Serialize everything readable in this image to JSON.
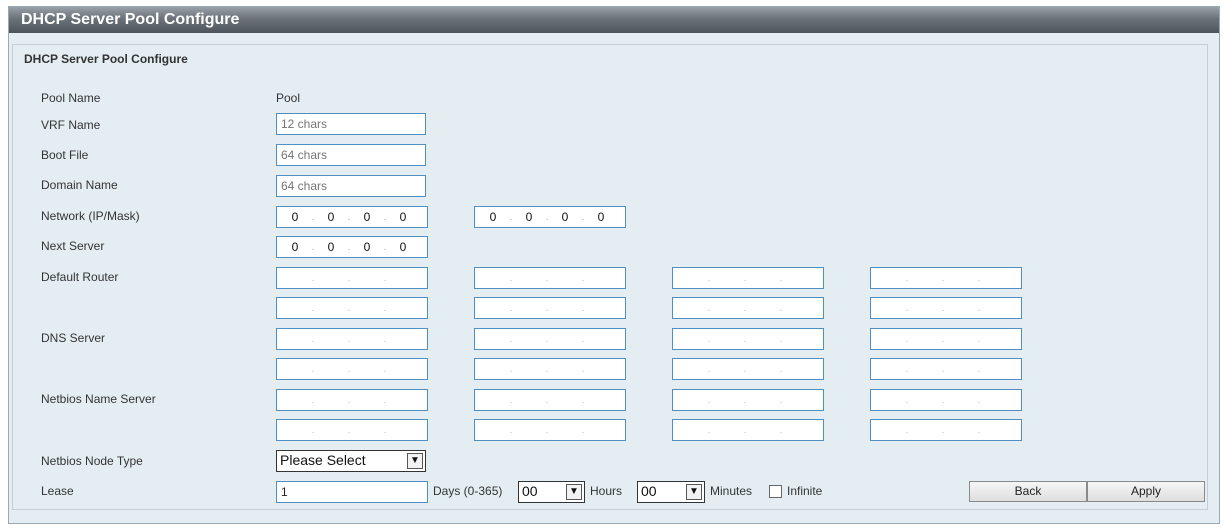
{
  "window": {
    "title": "DHCP Server Pool Configure"
  },
  "group_title": "DHCP Server Pool Configure",
  "labels": {
    "pool_name": "Pool Name",
    "vrf_name": "VRF Name",
    "boot_file": "Boot File",
    "domain_name": "Domain Name",
    "network": "Network (IP/Mask)",
    "next_server": "Next Server",
    "default_router": "Default Router",
    "dns_server": "DNS Server",
    "netbios_name_server": "Netbios Name Server",
    "netbios_node_type": "Netbios Node Type",
    "lease": "Lease"
  },
  "values": {
    "pool_name": "Pool",
    "vrf_placeholder": "12 chars",
    "boot_file_placeholder": "64 chars",
    "domain_name_placeholder": "64 chars",
    "ip_zero": "0",
    "ip_dot": "."
  },
  "netbios_node_type": {
    "selected": "Please Select"
  },
  "lease": {
    "days_value": "1",
    "days_label": "Days (0-365)",
    "hours_value": "00",
    "hours_label": "Hours",
    "minutes_value": "00",
    "minutes_label": "Minutes",
    "infinite_label": "Infinite",
    "infinite_checked": false
  },
  "buttons": {
    "back": "Back",
    "apply": "Apply"
  },
  "colors": {
    "input_border": "#4f8fc4",
    "panel_bg": "#e4eef2",
    "title_bg": "#4d545c"
  }
}
